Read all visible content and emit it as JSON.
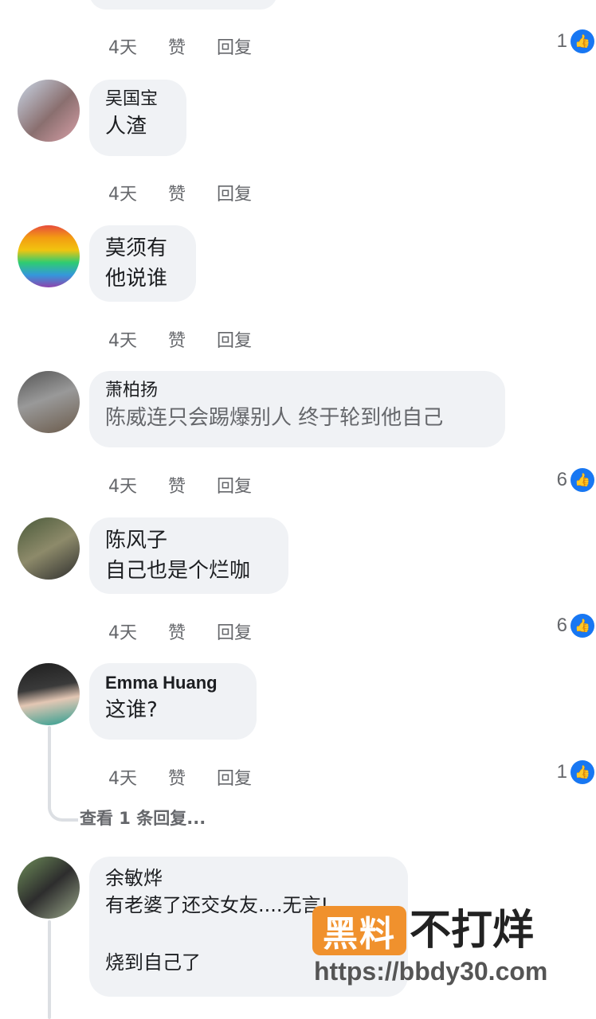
{
  "action_labels": {
    "like": "赞",
    "reply": "回复"
  },
  "top_item": {
    "time": "4天",
    "react_count": "1"
  },
  "comments": [
    {
      "name": "吴国宝",
      "text": "人渣",
      "time": "4天",
      "react_count": ""
    },
    {
      "name": "莫须有",
      "text": "他说谁",
      "time": "4天",
      "react_count": ""
    },
    {
      "name": "萧柏扬",
      "text": "陈威连只会踢爆别人 终于轮到他自己",
      "time": "4天",
      "react_count": "6"
    },
    {
      "name": "陈风子",
      "text": "自己也是个烂咖",
      "time": "4天",
      "react_count": "6"
    },
    {
      "name": "Emma Huang",
      "text": "这谁?",
      "time": "4天",
      "react_count": "1"
    },
    {
      "name": "余敏烨",
      "text": "有老婆了还交女友....无言!",
      "text2": "烧到自己了"
    }
  ],
  "view_replies": "查看 1 条回复...",
  "watermark": {
    "badge": "黑料",
    "text": "不打烊",
    "url": "https://bbdy30.com"
  },
  "colors": {
    "like_blue": "#1877f2",
    "bubble_bg": "#f0f2f5",
    "muted": "#65676b",
    "watermark_orange": "#f0912d"
  }
}
